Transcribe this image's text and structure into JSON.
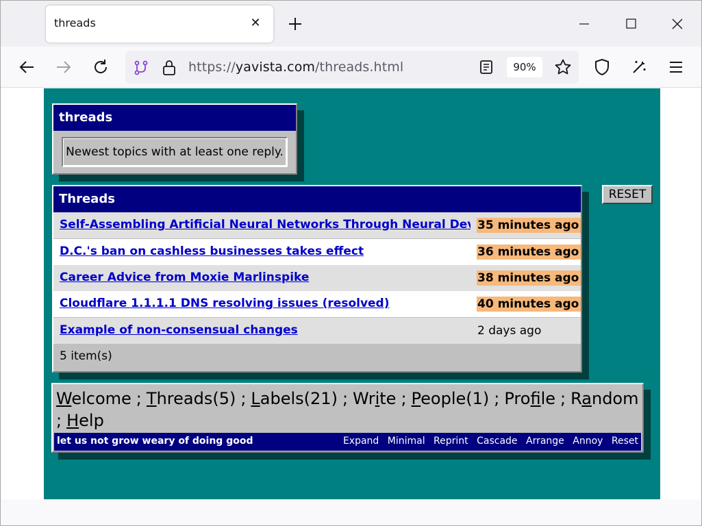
{
  "browser": {
    "tab_title": "threads",
    "url_prefix": "https://",
    "url_host": "yavista.com",
    "url_path": "/threads.html",
    "zoom": "90%"
  },
  "info_window": {
    "title": "threads",
    "description": "Newest topics with at least one reply."
  },
  "threads_window": {
    "title": "Threads",
    "rows": [
      {
        "title": "Self-Assembling Artificial Neural Networks Through Neural Devel",
        "age": "35 minutes ago",
        "hot": true
      },
      {
        "title": "D.C.'s ban on cashless businesses takes effect",
        "age": "36 minutes ago",
        "hot": true
      },
      {
        "title": "Career Advice from Moxie Marlinspike",
        "age": "38 minutes ago",
        "hot": true
      },
      {
        "title": "Cloudflare 1.1.1.1 DNS resolving issues (resolved)",
        "age": "40 minutes ago",
        "hot": true
      },
      {
        "title": "Example of non-consensual changes",
        "age": "2 days ago",
        "hot": false
      }
    ],
    "count": "5 item(s)",
    "highlight_color": "#f7b87a"
  },
  "reset_button": "RESET",
  "menu": {
    "items": [
      {
        "key": "W",
        "rest": "elcome",
        "pre": ""
      },
      {
        "key": "T",
        "rest": "hreads(5)",
        "pre": ""
      },
      {
        "key": "L",
        "rest": "abels(21)",
        "pre": ""
      },
      {
        "key": "i",
        "rest": "te",
        "pre": "Wr"
      },
      {
        "key": "P",
        "rest": "eople(1)",
        "pre": ""
      },
      {
        "key": "f",
        "rest": "ile",
        "pre": "Pro"
      },
      {
        "key": "a",
        "rest": "ndom",
        "pre": "R"
      },
      {
        "key": "H",
        "rest": "elp",
        "pre": ""
      }
    ],
    "motto": "let us not grow weary of doing good",
    "footer_links": [
      "Expand",
      "Minimal",
      "Reprint",
      "Cascade",
      "Arrange",
      "Annoy",
      "Reset"
    ]
  },
  "colors": {
    "page_bg": "#008080",
    "titlebar": "#000080",
    "window": "#c0c0c0"
  }
}
